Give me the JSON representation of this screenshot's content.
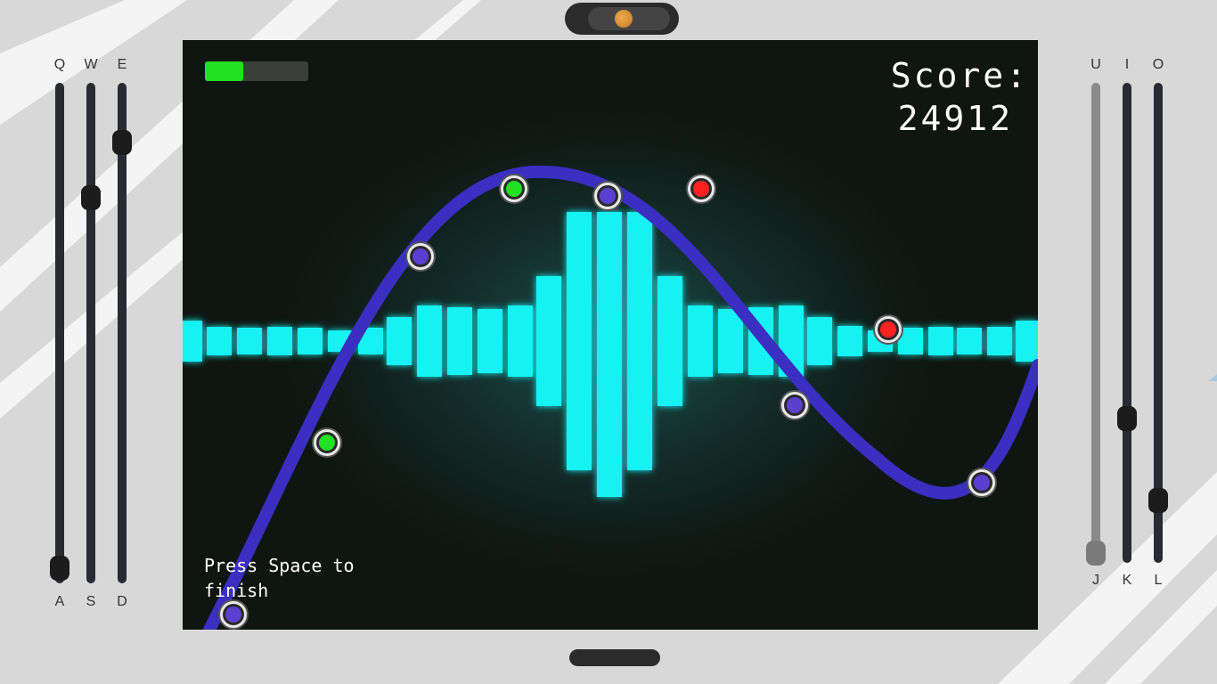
{
  "hud": {
    "score_label": "Score:",
    "score_value": "24912",
    "hint": "Press Space to finish",
    "progress": 0.37
  },
  "sliders_left": [
    {
      "top_key": "Q",
      "bottom_key": "A",
      "value": 0.03,
      "active": true
    },
    {
      "top_key": "W",
      "bottom_key": "S",
      "value": 0.77,
      "active": true
    },
    {
      "top_key": "E",
      "bottom_key": "D",
      "value": 0.88,
      "active": true
    }
  ],
  "sliders_right": [
    {
      "top_key": "U",
      "bottom_key": "J",
      "value": 0.02,
      "active": false
    },
    {
      "top_key": "I",
      "bottom_key": "K",
      "value": 0.3,
      "active": true
    },
    {
      "top_key": "O",
      "bottom_key": "L",
      "value": 0.13,
      "active": true
    }
  ],
  "colors": {
    "background": "#d8d8d8",
    "screen": "#0f1510",
    "wave": "#3a2fc0",
    "bars": "#19f2f2",
    "progress": "#22e022",
    "note_green": "#22e022",
    "note_purple": "#5a40d0",
    "note_red": "#ff2020"
  },
  "notes": [
    {
      "color": "purple"
    },
    {
      "color": "green"
    },
    {
      "color": "purple"
    },
    {
      "color": "green"
    },
    {
      "color": "purple"
    },
    {
      "color": "red"
    },
    {
      "color": "purple"
    },
    {
      "color": "red"
    },
    {
      "color": "purple"
    }
  ]
}
